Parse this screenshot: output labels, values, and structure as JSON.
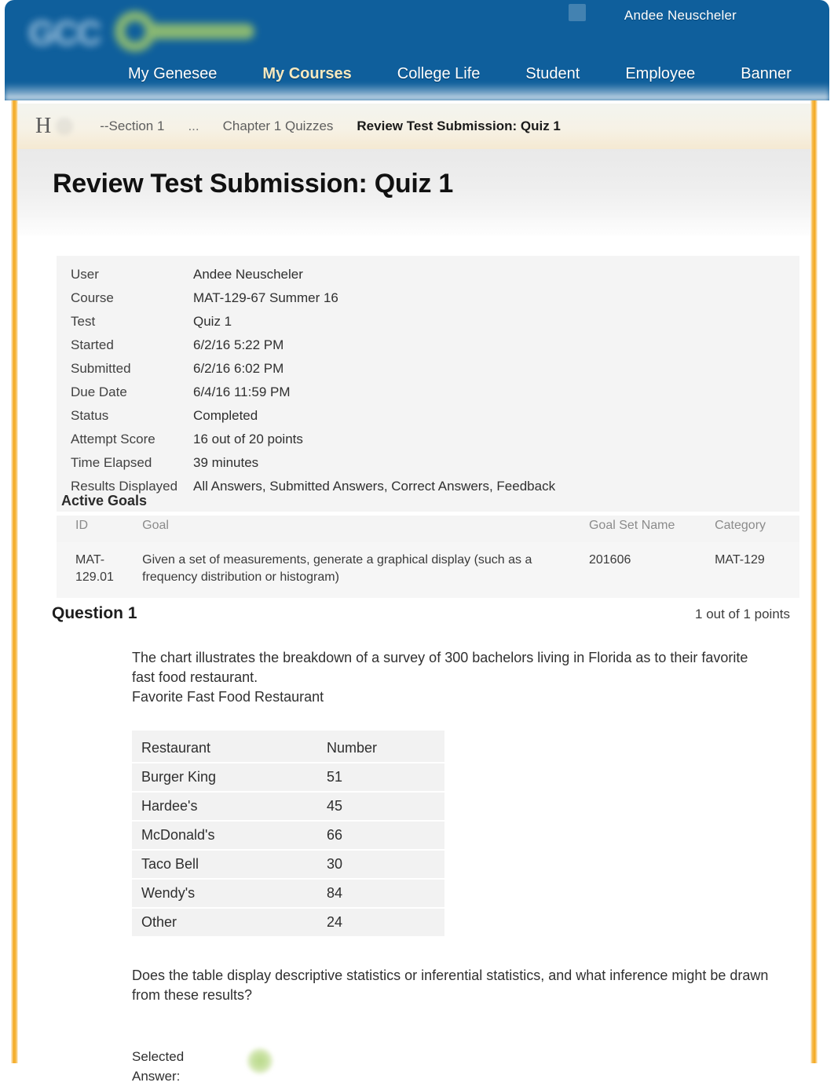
{
  "masthead": {
    "user_name": "Andee Neuscheler",
    "logo_text": "GCC",
    "nav": [
      {
        "label": "My Genesee",
        "active": false
      },
      {
        "label": "My Courses",
        "active": true
      },
      {
        "label": "College Life",
        "active": false
      },
      {
        "label": "Student",
        "active": false
      },
      {
        "label": "Employee",
        "active": false
      },
      {
        "label": "Banner",
        "active": false
      }
    ],
    "accent_blue": "#0f5f9c",
    "active_nav_color": "#f6e9bf"
  },
  "breadcrumb": {
    "home_glyph": "H",
    "items": [
      {
        "label": "--Section 1",
        "current": false
      },
      {
        "label": "...",
        "current": false
      },
      {
        "label": "Chapter 1 Quizzes",
        "current": false
      },
      {
        "label": "Review Test Submission: Quiz 1",
        "current": true
      }
    ]
  },
  "page": {
    "title": "Review Test Submission: Quiz 1"
  },
  "submission_info": [
    {
      "label": "User",
      "value": "Andee Neuscheler"
    },
    {
      "label": "Course",
      "value": "MAT-129-67 Summer 16"
    },
    {
      "label": "Test",
      "value": "Quiz 1"
    },
    {
      "label": "Started",
      "value": "6/2/16 5:22 PM"
    },
    {
      "label": "Submitted",
      "value": "6/2/16 6:02 PM"
    },
    {
      "label": "Due Date",
      "value": "6/4/16 11:59 PM"
    },
    {
      "label": "Status",
      "value": "Completed"
    },
    {
      "label": "Attempt Score",
      "value": "16 out of 20 points"
    },
    {
      "label": "Time Elapsed",
      "value": "39 minutes"
    },
    {
      "label": "Results Displayed",
      "value": "All Answers, Submitted Answers, Correct Answers, Feedback"
    }
  ],
  "active_goals": {
    "heading": "Active Goals",
    "columns": [
      "ID",
      "Goal",
      "Goal Set Name",
      "Category"
    ],
    "rows": [
      {
        "id": "MAT-129.01",
        "goal": "Given a set of measurements, generate a graphical display (such as a frequency distribution or histogram)",
        "goal_set_name": "201606",
        "category": "MAT-129"
      }
    ]
  },
  "question": {
    "label": "Question 1",
    "points": "1 out of 1 points",
    "prompt": "The chart illustrates the breakdown of a survey of 300 bachelors living in Florida as to their favorite fast food restaurant.",
    "caption": "Favorite Fast Food Restaurant",
    "followup": "Does the table display descriptive statistics or inferential statistics, and what inference might be drawn from these results?",
    "selected_answer_label": "Selected Answer:",
    "selected_answer_icon": "correct-answer-icon",
    "selected_answer_text": ""
  },
  "chart_data": {
    "type": "table",
    "title": "Favorite Fast Food Restaurant",
    "columns": [
      "Restaurant",
      "Number"
    ],
    "categories": [
      "Burger King",
      "Hardee's",
      "McDonald's",
      "Taco Bell",
      "Wendy's",
      "Other"
    ],
    "values": [
      51,
      45,
      66,
      30,
      84,
      24
    ],
    "total": 300,
    "xlabel": "Restaurant",
    "ylabel": "Number"
  }
}
